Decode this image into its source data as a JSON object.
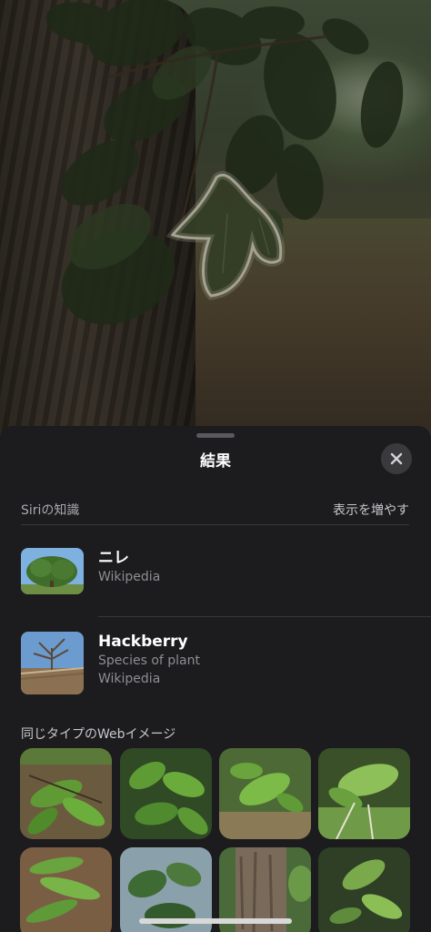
{
  "sheet": {
    "title": "結果",
    "close_icon": "xmark-icon"
  },
  "siri_knowledge": {
    "label": "Siriの知識",
    "more_label": "表示を増やす"
  },
  "results": [
    {
      "title": "ニレ",
      "subtitle": "Wikipedia",
      "source": ""
    },
    {
      "title": "Hackberry",
      "subtitle": "Species of plant",
      "source": "Wikipedia"
    }
  ],
  "web_images": {
    "label": "同じタイプのWebイメージ",
    "count_visible": 8
  },
  "colors": {
    "sheet_bg": "#1c1c1e",
    "secondary_text": "#8e8e93",
    "divider": "#38383a",
    "close_bg": "#3a3a3c"
  }
}
